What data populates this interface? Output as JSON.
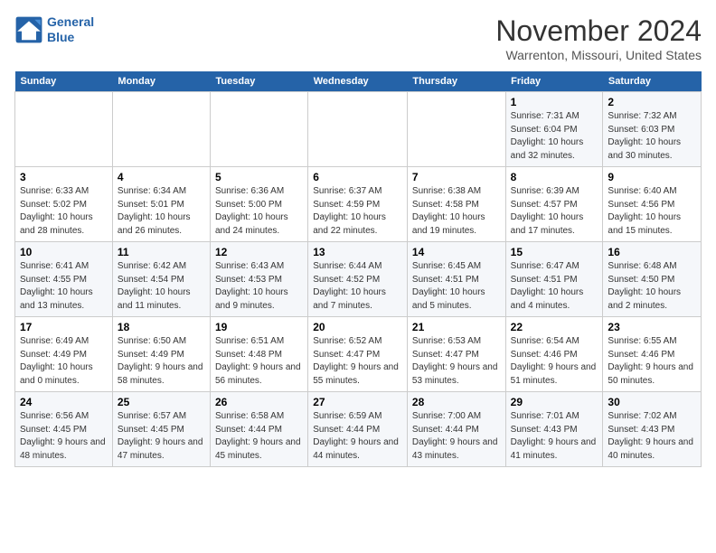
{
  "header": {
    "logo_line1": "General",
    "logo_line2": "Blue",
    "month": "November 2024",
    "location": "Warrenton, Missouri, United States"
  },
  "days_of_week": [
    "Sunday",
    "Monday",
    "Tuesday",
    "Wednesday",
    "Thursday",
    "Friday",
    "Saturday"
  ],
  "weeks": [
    [
      {
        "day": "",
        "info": ""
      },
      {
        "day": "",
        "info": ""
      },
      {
        "day": "",
        "info": ""
      },
      {
        "day": "",
        "info": ""
      },
      {
        "day": "",
        "info": ""
      },
      {
        "day": "1",
        "info": "Sunrise: 7:31 AM\nSunset: 6:04 PM\nDaylight: 10 hours and 32 minutes."
      },
      {
        "day": "2",
        "info": "Sunrise: 7:32 AM\nSunset: 6:03 PM\nDaylight: 10 hours and 30 minutes."
      }
    ],
    [
      {
        "day": "3",
        "info": "Sunrise: 6:33 AM\nSunset: 5:02 PM\nDaylight: 10 hours and 28 minutes."
      },
      {
        "day": "4",
        "info": "Sunrise: 6:34 AM\nSunset: 5:01 PM\nDaylight: 10 hours and 26 minutes."
      },
      {
        "day": "5",
        "info": "Sunrise: 6:36 AM\nSunset: 5:00 PM\nDaylight: 10 hours and 24 minutes."
      },
      {
        "day": "6",
        "info": "Sunrise: 6:37 AM\nSunset: 4:59 PM\nDaylight: 10 hours and 22 minutes."
      },
      {
        "day": "7",
        "info": "Sunrise: 6:38 AM\nSunset: 4:58 PM\nDaylight: 10 hours and 19 minutes."
      },
      {
        "day": "8",
        "info": "Sunrise: 6:39 AM\nSunset: 4:57 PM\nDaylight: 10 hours and 17 minutes."
      },
      {
        "day": "9",
        "info": "Sunrise: 6:40 AM\nSunset: 4:56 PM\nDaylight: 10 hours and 15 minutes."
      }
    ],
    [
      {
        "day": "10",
        "info": "Sunrise: 6:41 AM\nSunset: 4:55 PM\nDaylight: 10 hours and 13 minutes."
      },
      {
        "day": "11",
        "info": "Sunrise: 6:42 AM\nSunset: 4:54 PM\nDaylight: 10 hours and 11 minutes."
      },
      {
        "day": "12",
        "info": "Sunrise: 6:43 AM\nSunset: 4:53 PM\nDaylight: 10 hours and 9 minutes."
      },
      {
        "day": "13",
        "info": "Sunrise: 6:44 AM\nSunset: 4:52 PM\nDaylight: 10 hours and 7 minutes."
      },
      {
        "day": "14",
        "info": "Sunrise: 6:45 AM\nSunset: 4:51 PM\nDaylight: 10 hours and 5 minutes."
      },
      {
        "day": "15",
        "info": "Sunrise: 6:47 AM\nSunset: 4:51 PM\nDaylight: 10 hours and 4 minutes."
      },
      {
        "day": "16",
        "info": "Sunrise: 6:48 AM\nSunset: 4:50 PM\nDaylight: 10 hours and 2 minutes."
      }
    ],
    [
      {
        "day": "17",
        "info": "Sunrise: 6:49 AM\nSunset: 4:49 PM\nDaylight: 10 hours and 0 minutes."
      },
      {
        "day": "18",
        "info": "Sunrise: 6:50 AM\nSunset: 4:49 PM\nDaylight: 9 hours and 58 minutes."
      },
      {
        "day": "19",
        "info": "Sunrise: 6:51 AM\nSunset: 4:48 PM\nDaylight: 9 hours and 56 minutes."
      },
      {
        "day": "20",
        "info": "Sunrise: 6:52 AM\nSunset: 4:47 PM\nDaylight: 9 hours and 55 minutes."
      },
      {
        "day": "21",
        "info": "Sunrise: 6:53 AM\nSunset: 4:47 PM\nDaylight: 9 hours and 53 minutes."
      },
      {
        "day": "22",
        "info": "Sunrise: 6:54 AM\nSunset: 4:46 PM\nDaylight: 9 hours and 51 minutes."
      },
      {
        "day": "23",
        "info": "Sunrise: 6:55 AM\nSunset: 4:46 PM\nDaylight: 9 hours and 50 minutes."
      }
    ],
    [
      {
        "day": "24",
        "info": "Sunrise: 6:56 AM\nSunset: 4:45 PM\nDaylight: 9 hours and 48 minutes."
      },
      {
        "day": "25",
        "info": "Sunrise: 6:57 AM\nSunset: 4:45 PM\nDaylight: 9 hours and 47 minutes."
      },
      {
        "day": "26",
        "info": "Sunrise: 6:58 AM\nSunset: 4:44 PM\nDaylight: 9 hours and 45 minutes."
      },
      {
        "day": "27",
        "info": "Sunrise: 6:59 AM\nSunset: 4:44 PM\nDaylight: 9 hours and 44 minutes."
      },
      {
        "day": "28",
        "info": "Sunrise: 7:00 AM\nSunset: 4:44 PM\nDaylight: 9 hours and 43 minutes."
      },
      {
        "day": "29",
        "info": "Sunrise: 7:01 AM\nSunset: 4:43 PM\nDaylight: 9 hours and 41 minutes."
      },
      {
        "day": "30",
        "info": "Sunrise: 7:02 AM\nSunset: 4:43 PM\nDaylight: 9 hours and 40 minutes."
      }
    ]
  ]
}
